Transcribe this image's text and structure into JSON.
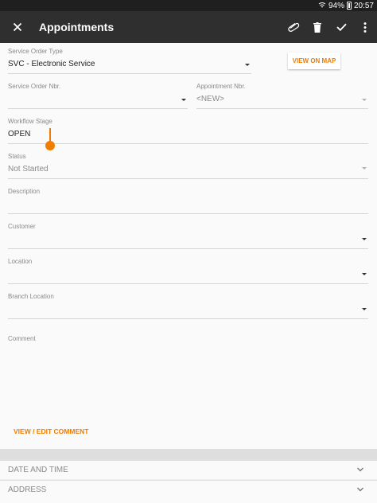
{
  "status_bar": {
    "battery": "94%",
    "time": "20:57"
  },
  "header": {
    "title": "Appointments"
  },
  "form": {
    "service_order_type": {
      "label": "Service Order Type",
      "value": "SVC - Electronic Service"
    },
    "map_button": "VIEW ON MAP",
    "service_order_nbr": {
      "label": "Service Order Nbr.",
      "value": ""
    },
    "appointment_nbr": {
      "label": "Appointment Nbr.",
      "value": "<NEW>"
    },
    "workflow_stage": {
      "label": "Workflow Stage",
      "value": "OPEN"
    },
    "status": {
      "label": "Status",
      "value": "Not Started"
    },
    "description": {
      "label": "Description",
      "value": ""
    },
    "customer": {
      "label": "Customer",
      "value": ""
    },
    "location": {
      "label": "Location",
      "value": ""
    },
    "branch_location": {
      "label": "Branch Location",
      "value": ""
    },
    "comment": {
      "label": "Comment",
      "value": ""
    },
    "edit_comment": "VIEW / EDIT COMMENT"
  },
  "sections": [
    {
      "title": "DATE AND TIME"
    },
    {
      "title": "ADDRESS"
    }
  ],
  "colors": {
    "accent": "#ef7d00",
    "appbar": "#2f2f2f",
    "statusbar": "#1f1f1f"
  }
}
